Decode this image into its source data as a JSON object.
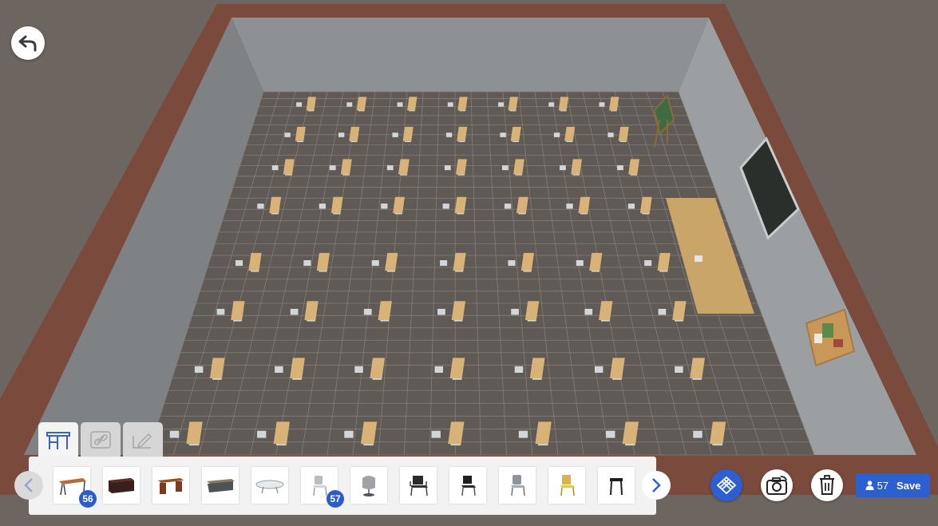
{
  "scene": {
    "desk_rows": 8,
    "desks_per_row": 7
  },
  "toolbar": {
    "tabs": [
      {
        "icon": "desk-icon",
        "active": true
      },
      {
        "icon": "link-icon",
        "active": false
      },
      {
        "icon": "edit-icon",
        "active": false
      }
    ],
    "items": [
      {
        "icon": "wooden-desk-icon",
        "badge": "56"
      },
      {
        "icon": "dark-cabinet-icon",
        "badge": ""
      },
      {
        "icon": "teacher-desk-icon",
        "badge": ""
      },
      {
        "icon": "gray-desk-icon",
        "badge": ""
      },
      {
        "icon": "glass-table-icon",
        "badge": ""
      },
      {
        "icon": "student-chair-icon",
        "badge": "57"
      },
      {
        "icon": "lounge-chair-icon",
        "badge": ""
      },
      {
        "icon": "black-armchair-icon",
        "badge": ""
      },
      {
        "icon": "black-chair-icon",
        "badge": ""
      },
      {
        "icon": "gray-chair-icon",
        "badge": ""
      },
      {
        "icon": "yellow-chair-icon",
        "badge": ""
      },
      {
        "icon": "stool-icon",
        "badge": ""
      }
    ]
  },
  "save": {
    "count": "57",
    "label": "Save"
  },
  "colors": {
    "accent": "#2e5fd0",
    "badge": "#2b5cc9",
    "wall_frame": "#7a4a3c",
    "wall": "#8a8e90",
    "floor": "#5f5a55",
    "desk": "#d8b276"
  }
}
